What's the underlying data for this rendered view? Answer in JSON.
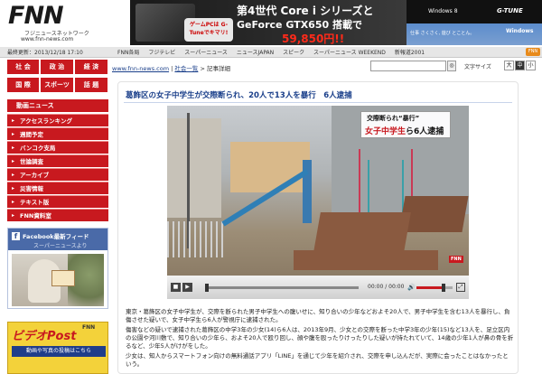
{
  "header": {
    "logo": "FNN",
    "logo_sub": "フジニュースネットワーク",
    "logo_url": "www.fnn-news.com",
    "ad": {
      "line1": "第4世代 Core i シリーズと",
      "line2": "GeForce GTX650 搭載で",
      "price": "59,850円!!",
      "badge": "ゲームPCは G-Tuneでキマリ!"
    },
    "win": {
      "os": "Windows 8",
      "brand": "G-TUNE",
      "msg": "仕事 さくさく, 遊び とことん。",
      "win_logo": "Windows"
    }
  },
  "nav": {
    "date": "最終更新：2013/12/18 17:10",
    "links": [
      "FNN各局",
      "フジテレビ",
      "スーパーニュース",
      "ニュースJAPAN",
      "スピーク",
      "スーパーニュース WEEKEND",
      "新報道2001"
    ],
    "badge": "FNN"
  },
  "sidebar": {
    "cats_row1": [
      "社 会",
      "政 治",
      "経 済"
    ],
    "cats_row2": [
      "国 際",
      "スポーツ",
      "話 題"
    ],
    "menu_header": "動画ニュース",
    "menu_items": [
      "アクセスランキング",
      "週間予定",
      "バンコク支局",
      "世論調査",
      "アーカイブ",
      "災害情報",
      "テキスト版",
      "FNN資料室"
    ],
    "fb_title": "Facebook最新フィード",
    "fb_sub": "スーパーニュースより",
    "vpost_title": "ビデオPost",
    "vpost_fnn": "FNN",
    "vpost_sub": "動画や写真の投稿はこちら"
  },
  "main": {
    "breadcrumb_site": "www.fnn-news.com",
    "breadcrumb_sep1": " | ",
    "breadcrumb_list": "社会一覧",
    "breadcrumb_sep2": " > 記事詳細",
    "search_btn": "◎",
    "fontsize_label": "文字サイズ",
    "fontsizes": [
      "大",
      "中",
      "小"
    ],
    "headline": "葛飾区の女子中学生が交際断られ、20人で13人を暴行　6人逮捕",
    "caption_line1": "交際断られ“暴行”",
    "caption_hl": "女子中学生",
    "caption_rest": "ら6人逮捕",
    "watermark": "FNN",
    "player": {
      "stop": "■",
      "play": "▶",
      "time": "00:00 / 00:00",
      "volume_icon": "🔊",
      "fullscreen": "⤢",
      "progress": 0.0,
      "volume": 0.75
    },
    "body": [
      "東京・葛飾区の女子中学生が、交際を断られた男子中学生への腹いせに、知り合いの少年などおよそ20人で、男子中学生を含む13人を暴行し、負傷させた疑いで、女子中学生ら6人が警視庁に逮捕された。",
      "傷害などの疑いで逮捕された葛飾区の中学3年の少女(14)ら6人は、2013年9月、少女との交際を断った中学3年の少年(15)など13人を、足立区内の公園や河川敷で、知り合いの少年ら、およそ20人で殴り回し、顔や腹を殴ったりけったりした疑いが持たれていて、14歳の少年1人が鼻の骨を折るなど、少年5人がけがをした。",
      "少女は、知人からスマートフォン向けの無料通話アプリ「LINE」を通じて少年を紹介され、交際を申し込んだが、実際に会ったことはなかったという。"
    ]
  }
}
